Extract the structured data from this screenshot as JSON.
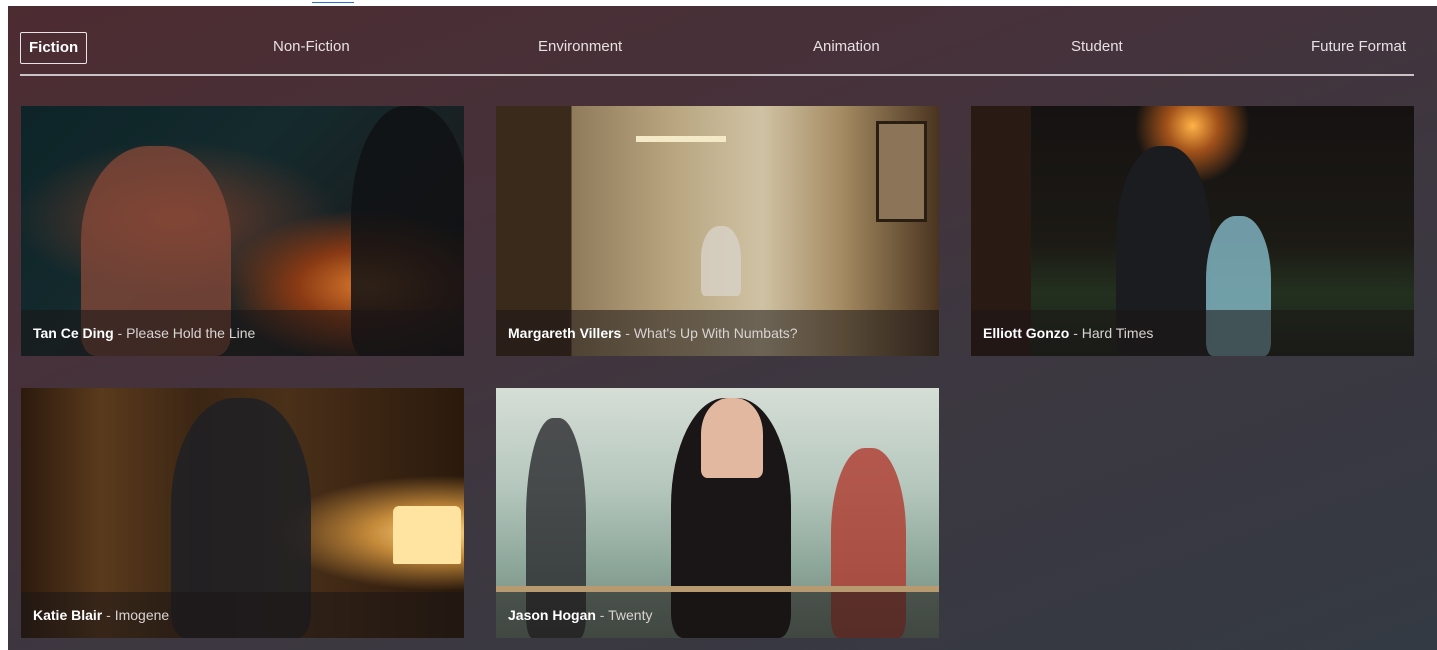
{
  "nav": {
    "tabs": [
      {
        "label": "Fiction",
        "active": true
      },
      {
        "label": "Non-Fiction",
        "active": false
      },
      {
        "label": "Environment",
        "active": false
      },
      {
        "label": "Animation",
        "active": false
      },
      {
        "label": "Student",
        "active": false
      },
      {
        "label": "Future Format",
        "active": false
      }
    ]
  },
  "films": [
    {
      "director": "Tan Ce Ding",
      "title": "Please Hold the Line"
    },
    {
      "director": "Margareth Villers",
      "title": "What's Up With Numbats?"
    },
    {
      "director": "Elliott Gonzo",
      "title": "Hard Times"
    },
    {
      "director": "Katie Blair",
      "title": "Imogene"
    },
    {
      "director": "Jason Hogan",
      "title": "Twenty"
    }
  ],
  "caption_separator": " - ",
  "colors": {
    "accent": "#ffffff",
    "nav_divider": "#c9c3c5",
    "background_top": "#4c2c31",
    "background_bottom": "#343a43"
  }
}
